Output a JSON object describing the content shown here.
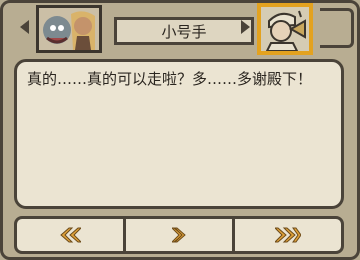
{
  "header": {
    "speaker_name": "小号手"
  },
  "dialog": {
    "text": "真的……真的可以走啦？多……多谢殿下！"
  },
  "controls": {
    "prev_icon": "double-chevron-left-icon",
    "next_icon": "chevron-right-icon",
    "skip_icon": "double-chevron-right-icon"
  },
  "colors": {
    "panel": "#b8ad92",
    "border": "#4a4339",
    "text_bg": "#ebe4d2",
    "highlight": "#e3a21f",
    "arrow_fill": "#e0a23a"
  }
}
